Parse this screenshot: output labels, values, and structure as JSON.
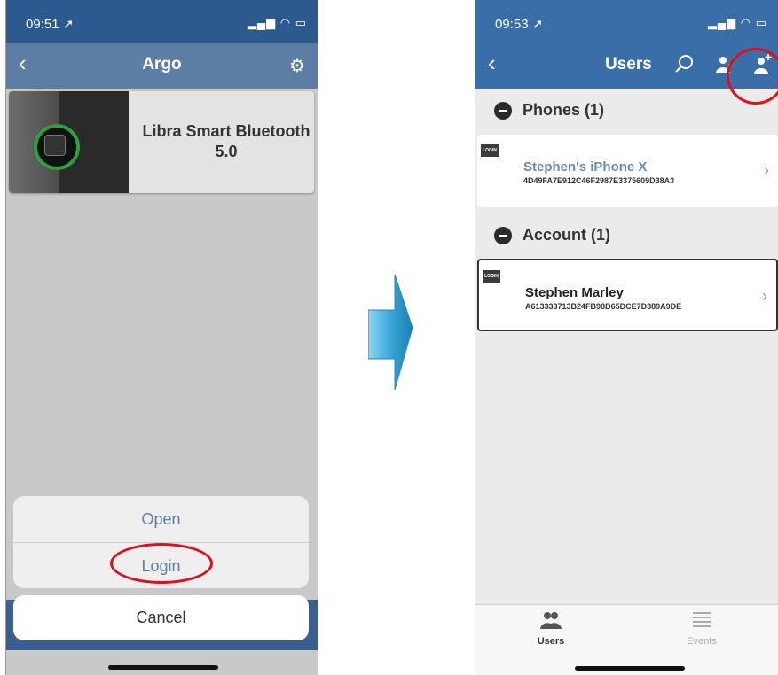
{
  "left_screen": {
    "status_time": "09:51",
    "nav_title": "Argo",
    "lock_name_line1": "Libra Smart Bluetooth",
    "lock_name_line2": "5.0",
    "actions": {
      "open": "Open",
      "login": "Login",
      "cancel": "Cancel"
    }
  },
  "right_screen": {
    "status_time": "09:53",
    "nav_title": "Users",
    "sections": {
      "phones": "Phones (1)",
      "account": "Account (1)"
    },
    "phone_item": {
      "badge": "LOGIN",
      "name": "Stephen's iPhone X",
      "id": "4D49FA7E912C46F2987E3375609D38A3"
    },
    "account_item": {
      "badge": "LOGIN",
      "name": "Stephen Marley",
      "id": "A613333713B24FB98D65DCE7D389A9DE"
    },
    "tabs": {
      "users": "Users",
      "events": "Events"
    }
  },
  "colors": {
    "nav_blue": "#3a6ea8",
    "highlight_ring": "#e0101a",
    "arrow_fill": "#3aa6d8",
    "phone_name_color": "#6a8aa8"
  },
  "icons": [
    "back-chevron-icon",
    "gear-icon",
    "search-icon",
    "edit-user-icon",
    "add-user-icon",
    "users-tab-icon",
    "events-tab-icon",
    "chevron-right-icon",
    "signal-icon",
    "wifi-icon",
    "battery-icon",
    "location-arrow-icon"
  ]
}
